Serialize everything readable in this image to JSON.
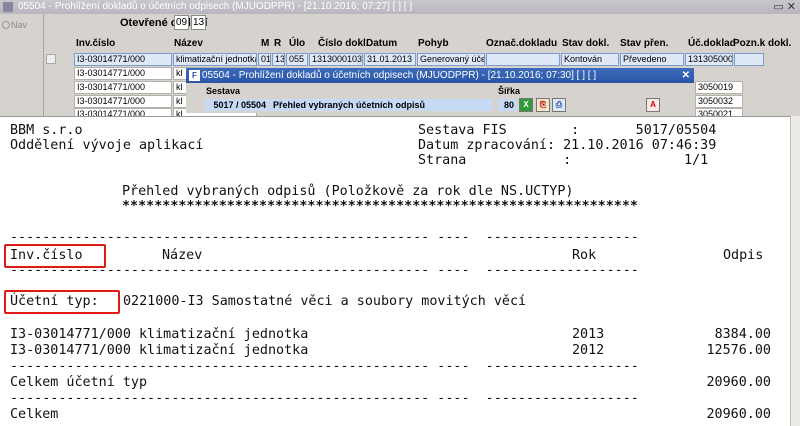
{
  "bg_window": {
    "title": "05504 - Prohlížení dokladů o účetních odpisech (MJUODPPR) - [21.10.2016; 07:27] [ ] [ ]",
    "nav_label": "Nav",
    "period_label": "Otevřené období",
    "period_values": [
      "09",
      "13"
    ]
  },
  "grid": {
    "headers": [
      "Inv.číslo",
      "Název",
      "M",
      "R",
      "Úlo",
      "Číslo dokl.",
      "Datum",
      "Pohyb",
      "Označ.dokladu",
      "Stav dokl.",
      "Stav přen.",
      "Úč.doklad",
      "Pozn.k dokl."
    ],
    "rows": [
      {
        "inv": "I3-03014771/000",
        "nazev": "klimatizační jednotka",
        "m": "01",
        "r": "13",
        "ulo": "055",
        "cislo": "1313000103",
        "datum": "31.01.2013",
        "pohyb": "Generovaný účet",
        "oznac": "",
        "stav": "Kontován",
        "stav_pren": "Převedeno",
        "uc_doklad": "1313050003",
        "pozn": ""
      },
      {
        "inv": "I3-03014771/000",
        "nazev": "kl",
        "uc_doklad": ""
      },
      {
        "inv": "I3-03014771/000",
        "nazev": "kl",
        "uc_doklad": "3050019"
      },
      {
        "inv": "I3-03014771/000",
        "nazev": "kl",
        "uc_doklad": "3050032"
      },
      {
        "inv": "I3-03014771/000",
        "nazev": "kl",
        "uc_doklad": "3050021"
      }
    ]
  },
  "dialog": {
    "logo": "F",
    "title": "05504 - Prohlížení dokladů o účetních odpisech (MJUODPPR) - [21.10.2016; 07:30] [ ] [ ]",
    "close": "✕",
    "sestava_label": "Sestava",
    "sestava_code": "5017 / 05504",
    "sestava_name": "Přehled vybraných účetních odpisů",
    "sirka_label": "Šířka",
    "sirka_value": "80"
  },
  "report": {
    "company": "BBM s.r.o",
    "department": "Oddělení vývoje aplikací",
    "sestava_line": "Sestava FIS        :       5017/05504",
    "datum_line": "Datum zpracování: 21.10.2016 07:46:39",
    "strana_line": "Strana            :              1/1",
    "heading": "Přehled vybraných odpisů (Položkově za rok dle NS.UCTYP)",
    "heading_stars": "****************************************************************",
    "dash_line": "---------------------------------------------------- ----  -------------------",
    "col_inv": "Inv.číslo",
    "col_nazev": "Název",
    "col_rok": "Rok",
    "col_odpis": "Odpis",
    "ucetni_typ_label": "Účetní typ:",
    "ucetni_typ_value": "0221000-I3 Samostatné věci a soubory movitých věcí",
    "lines": [
      {
        "inv": "I3-03014771/000",
        "nazev": "klimatizační jednotka",
        "rok": "2013",
        "odpis": "8384.00"
      },
      {
        "inv": "I3-03014771/000",
        "nazev": "klimatizační jednotka",
        "rok": "2012",
        "odpis": "12576.00"
      }
    ],
    "subtotal_label": "Celkem účetní typ",
    "subtotal_value": "20960.00",
    "total_label": "Celkem",
    "total_value": "20960.00"
  }
}
